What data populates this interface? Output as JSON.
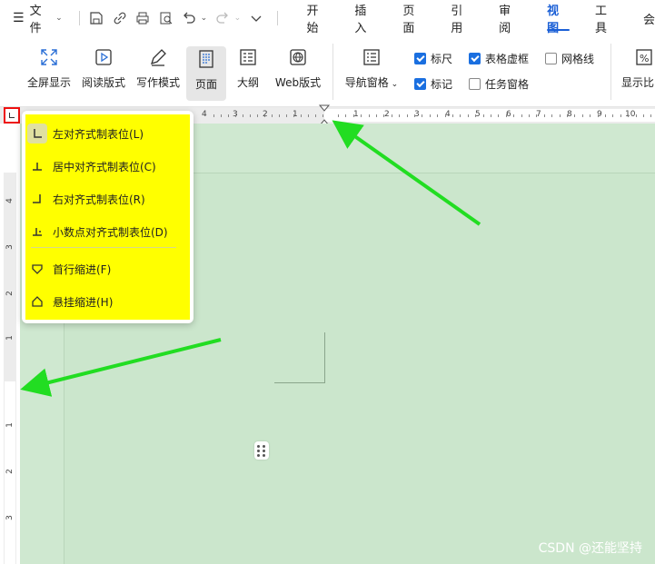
{
  "menubar": {
    "file_label": "文件",
    "tabs": [
      {
        "label": "开始"
      },
      {
        "label": "插入"
      },
      {
        "label": "页面"
      },
      {
        "label": "引用"
      },
      {
        "label": "审阅"
      },
      {
        "label": "视图",
        "active": true
      },
      {
        "label": "工具"
      },
      {
        "label": "会"
      }
    ]
  },
  "ribbon": {
    "buttons": [
      {
        "label": "全屏显示",
        "icon": "fullscreen-icon"
      },
      {
        "label": "阅读版式",
        "icon": "read-mode-icon"
      },
      {
        "label": "写作模式",
        "icon": "write-mode-icon"
      },
      {
        "label": "页面",
        "icon": "page-view-icon",
        "selected": true
      },
      {
        "label": "大纲",
        "icon": "outline-icon"
      },
      {
        "label": "Web版式",
        "icon": "web-layout-icon"
      },
      {
        "label": "导航窗格",
        "icon": "nav-pane-icon"
      },
      {
        "label": "显示比",
        "icon": "zoom-icon"
      }
    ],
    "checkboxes": [
      {
        "label": "标尺",
        "checked": true
      },
      {
        "label": "表格虚框",
        "checked": true
      },
      {
        "label": "网格线",
        "checked": false
      },
      {
        "label": "标记",
        "checked": true
      },
      {
        "label": "任务窗格",
        "checked": false
      }
    ]
  },
  "ruler": {
    "h_numbers": [
      "4",
      "3",
      "2",
      "1",
      "1",
      "2",
      "3",
      "4",
      "5",
      "6",
      "7",
      "8",
      "9",
      "10"
    ],
    "v_numbers": [
      "4",
      "3",
      "2",
      "1",
      "1",
      "2",
      "3"
    ]
  },
  "dropdown": {
    "items": [
      {
        "label": "左对齐式制表位(L)",
        "icon": "left-tab-icon"
      },
      {
        "label": "居中对齐式制表位(C)",
        "icon": "center-tab-icon"
      },
      {
        "label": "右对齐式制表位(R)",
        "icon": "right-tab-icon"
      },
      {
        "label": "小数点对齐式制表位(D)",
        "icon": "decimal-tab-icon"
      },
      {
        "label": "首行缩进(F)",
        "icon": "first-line-indent-icon"
      },
      {
        "label": "悬挂缩进(H)",
        "icon": "hanging-indent-icon"
      }
    ]
  },
  "watermark": "CSDN @还能坚持",
  "colors": {
    "accent": "#1a5fd6",
    "highlight": "#ffff00",
    "doc_bg": "#cfe8d0",
    "arrow": "#22dd22"
  }
}
